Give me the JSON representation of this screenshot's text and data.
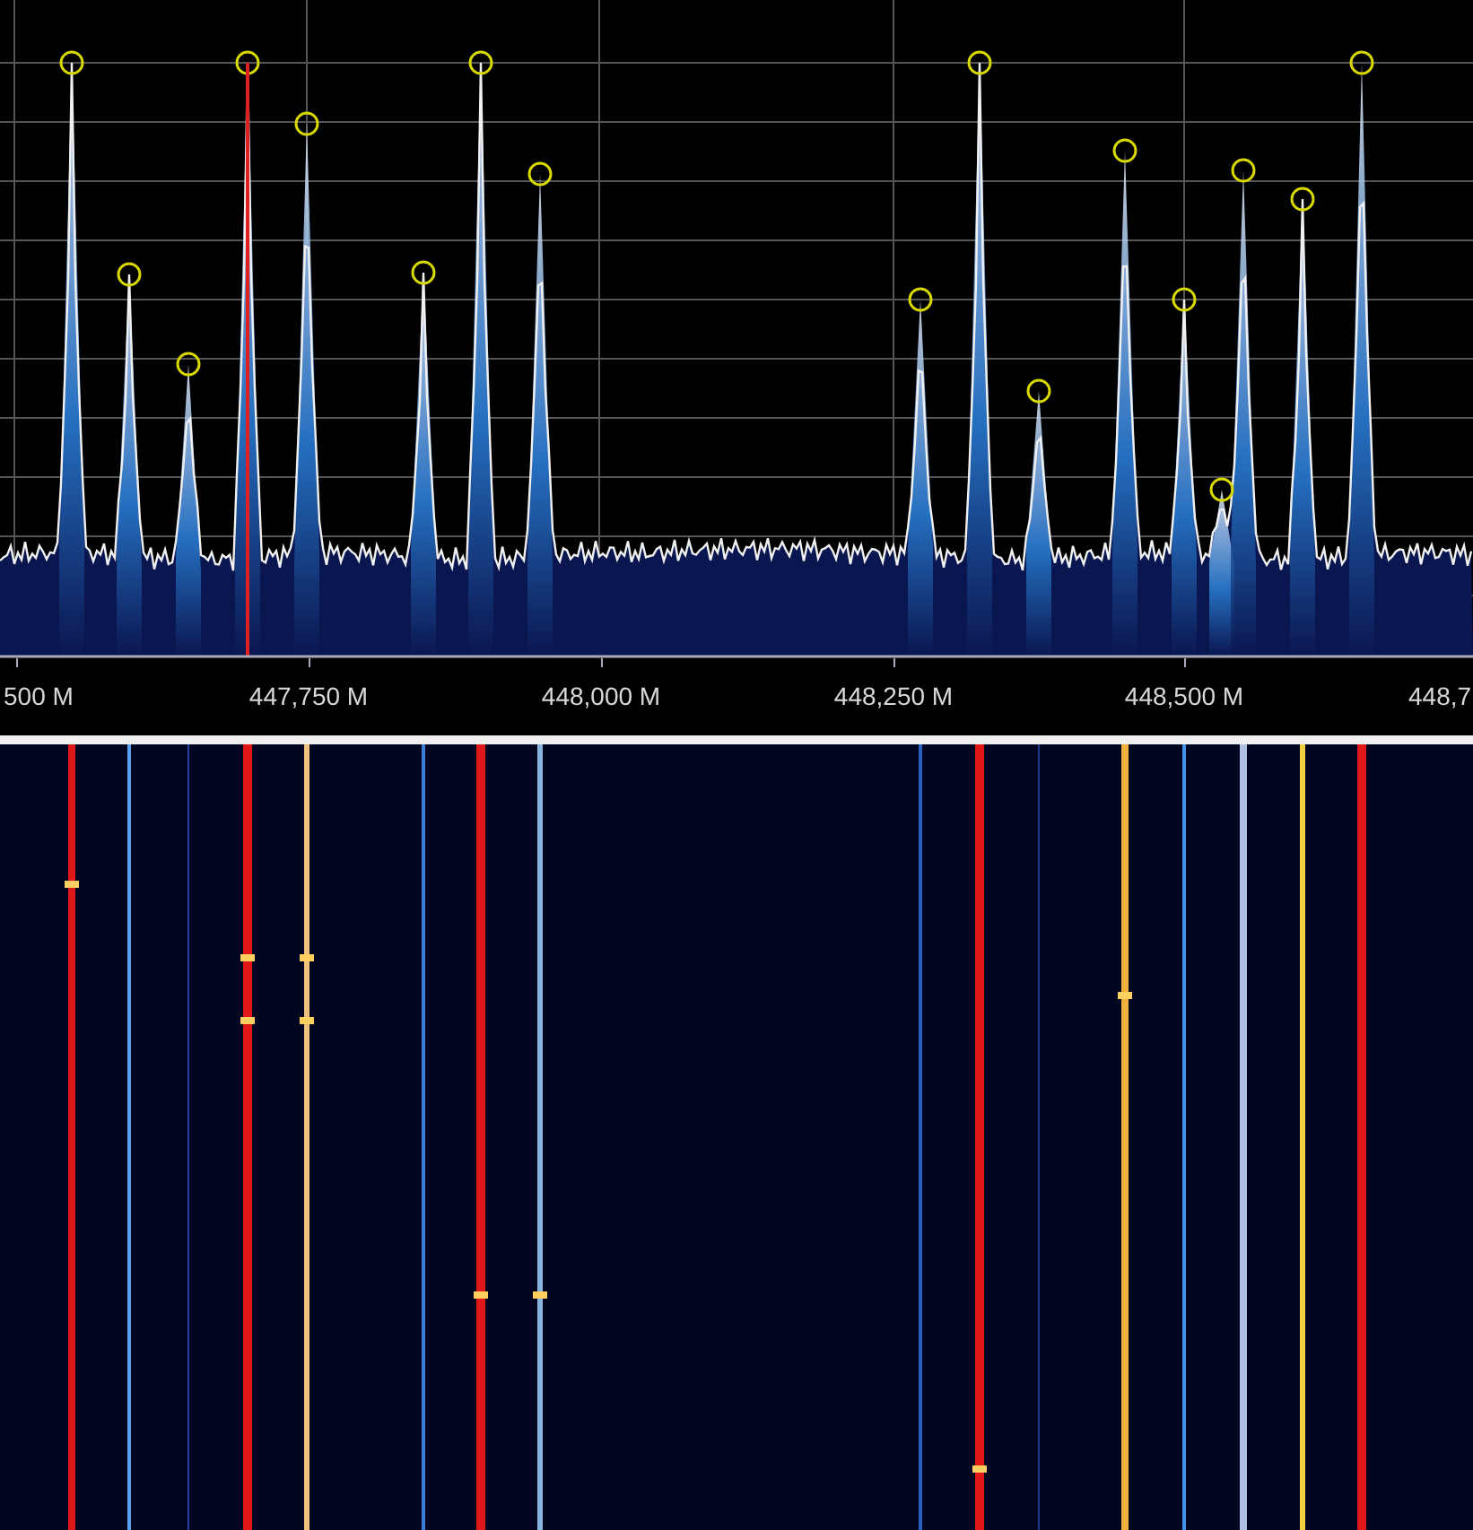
{
  "frequency_axis": {
    "labels": [
      "500 M",
      "447,750 M",
      "448,000 M",
      "448,250 M",
      "448,500 M",
      "448,7"
    ]
  }
}
